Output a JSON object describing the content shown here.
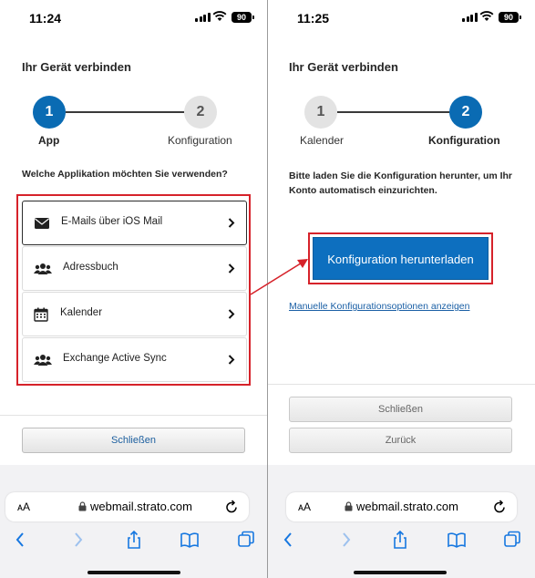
{
  "left_screen": {
    "status": {
      "time": "11:24",
      "battery": "90"
    },
    "page_title": "Ihr Gerät verbinden",
    "steps": [
      {
        "number": "1",
        "label": "App"
      },
      {
        "number": "2",
        "label": "Konfiguration"
      }
    ],
    "question": "Welche Applikation möchten Sie verwenden?",
    "apps": [
      {
        "label": "E-Mails über iOS Mail",
        "icon": "envelope-icon"
      },
      {
        "label": "Adressbuch",
        "icon": "users-icon"
      },
      {
        "label": "Kalender",
        "icon": "calendar-icon"
      },
      {
        "label": "Exchange Active Sync",
        "icon": "users-icon"
      }
    ],
    "close_button": "Schließen",
    "browser": {
      "aa": "AA",
      "url": "webmail.strato.com"
    }
  },
  "right_screen": {
    "status": {
      "time": "11:25",
      "battery": "90"
    },
    "page_title": "Ihr Gerät verbinden",
    "steps": [
      {
        "number": "1",
        "label": "Kalender"
      },
      {
        "number": "2",
        "label": "Konfiguration"
      }
    ],
    "info_text": "Bitte laden Sie die Konfiguration herunter, um Ihr Konto automatisch einzurichten.",
    "download_button": "Konfiguration herunterladen",
    "manual_link": "Manuelle Konfigurationsoptionen anzeigen",
    "close_button": "Schließen",
    "back_button": "Zurück",
    "browser": {
      "aa": "AA",
      "url": "webmail.strato.com"
    }
  },
  "colors": {
    "accent_blue": "#0a6bb3",
    "highlight_red": "#d6222a",
    "link_blue": "#1a5fa5"
  }
}
